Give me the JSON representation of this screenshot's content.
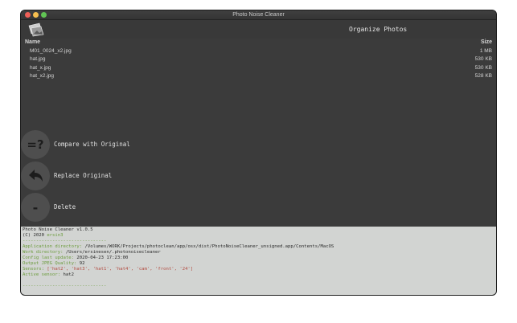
{
  "window": {
    "title": "Photo Noise Cleaner"
  },
  "toolbar": {
    "organize_label": "Organize Photos"
  },
  "file_list": {
    "col_name": "Name",
    "col_size": "Size",
    "rows": [
      {
        "name": "M01_0024_x2.jpg",
        "size": "1 MB"
      },
      {
        "name": "hat.jpg",
        "size": "530 KB"
      },
      {
        "name": "hat_x.jpg",
        "size": "530 KB"
      },
      {
        "name": "hat_x2.jpg",
        "size": "528 KB"
      }
    ]
  },
  "actions": {
    "compare": {
      "glyph": "=?",
      "label": "Compare with Original"
    },
    "replace": {
      "label": "Replace Original"
    },
    "delete": {
      "glyph": "-",
      "label": "Delete"
    }
  },
  "console": {
    "line1": "Photo Noise Cleaner v1.0.5",
    "line2_a": "(C) 2020 ",
    "line2_b": "ersin3",
    "separator": "-------------------------------",
    "app_dir_key": "Application directory: ",
    "app_dir_val": "/Volumes/WORK/Projects/photoclean/app/osx/dist/PhotoNoiseCleaner_unsigned.app/Contents/MacOS",
    "work_dir_key": "Work directory: ",
    "work_dir_val": "/Users/ersinesen/.photonoisecleaner",
    "config_key": "Config last update: ",
    "config_val": "2020-04-23 17:23:00",
    "quality_key": "Output JPEG Quality: ",
    "quality_val": "92",
    "sensors_key": "Sensors: ",
    "sensors_val": "['hat2', 'hat3', 'hat1', 'hat4', 'cam', 'front', '24']",
    "active_key": "Active sensor: ",
    "active_val": "hat2",
    "separator2": "-------------------------------"
  }
}
